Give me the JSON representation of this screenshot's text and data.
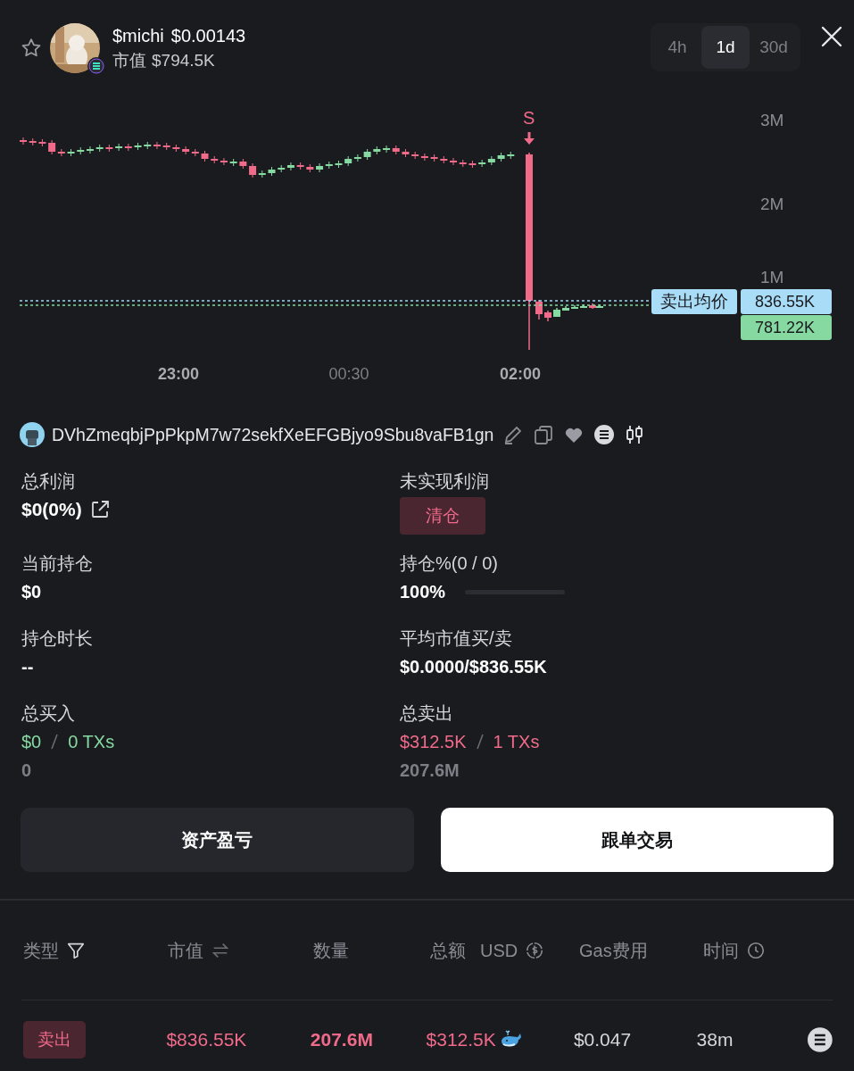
{
  "header": {
    "favorite": false,
    "symbol": "$michi",
    "price": "$0.00143",
    "market_cap_label": "市值",
    "market_cap": "$794.5K"
  },
  "timeframes": [
    {
      "label": "4h",
      "selected": false
    },
    {
      "label": "1d",
      "selected": true
    },
    {
      "label": "30d",
      "selected": false
    }
  ],
  "chart": {
    "signal": "S",
    "y_labels": [
      "3M",
      "2M",
      "1M"
    ],
    "x_labels": [
      {
        "label": "23:00",
        "emphasized": true
      },
      {
        "label": "00:30",
        "emphasized": false
      },
      {
        "label": "02:00",
        "emphasized": true
      }
    ],
    "avg_sell_label": "卖出均价",
    "avg_sell_value": "836.55K",
    "current_value": "781.22K"
  },
  "wallet": {
    "address": "DVhZmeqbjPpPkpM7w72sekfXeEFGBjyo9Sbu8vaFB1gn"
  },
  "stats": [
    {
      "kind": "value-link",
      "label": "总利润",
      "value": "$0(0%)"
    },
    {
      "kind": "badge",
      "label": "未实现利润",
      "value": "清仓"
    },
    {
      "kind": "value",
      "label": "当前持仓",
      "value": "$0"
    },
    {
      "kind": "progress",
      "label": "持仓%(0 / 0)",
      "value": "100%",
      "level": 0
    },
    {
      "kind": "value",
      "label": "持仓时长",
      "value": "--"
    },
    {
      "kind": "value",
      "label": "平均市值买/卖",
      "value": "$0.0000/$836.55K"
    },
    {
      "kind": "trades",
      "color": "#86d9a0",
      "label": "总买入",
      "amount": "$0",
      "txs": "0 TXs",
      "quantity": "0"
    },
    {
      "kind": "trades",
      "color": "#f06a8a",
      "label": "总卖出",
      "amount": "$312.5K",
      "txs": "1 TXs",
      "quantity": "207.6M"
    }
  ],
  "buttons": [
    {
      "label": "资产盈亏",
      "primary": false
    },
    {
      "label": "跟单交易",
      "primary": true
    }
  ],
  "table": {
    "columns": [
      {
        "kind": "filter",
        "label": "类型"
      },
      {
        "kind": "swap",
        "label": "市值"
      },
      {
        "kind": "plain",
        "label": "数量"
      },
      {
        "kind": "currency",
        "label": "总额",
        "unit": "USD"
      },
      {
        "kind": "plain",
        "label": "Gas费用"
      },
      {
        "kind": "clock",
        "label": "时间"
      }
    ],
    "rows": [
      {
        "color": "#f06a8a",
        "type": "卖出",
        "market_cap": "$836.55K",
        "quantity": "207.6M",
        "total": "$312.5K",
        "whale": true,
        "gas": "$0.047",
        "time": "38m"
      }
    ]
  }
}
